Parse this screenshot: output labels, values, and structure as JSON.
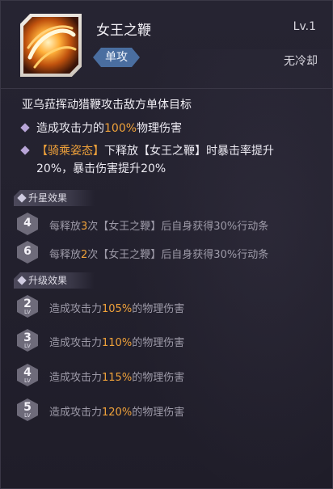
{
  "skill": {
    "name": "女王之鞭",
    "level": "Lv.1",
    "tag": "单攻",
    "cooldown": "无冷却",
    "description": "亚乌菈挥动猎鞭攻击敌方单体目标",
    "icon": "whip-slash-icon"
  },
  "effects": [
    {
      "pre": "造成攻击力的",
      "hl": "100%",
      "post": "物理伤害"
    },
    {
      "hl": "【骑乘姿态】",
      "post": "下释放【女王之鞭】时暴击率提升",
      "line2": "20%，暴击伤害提升20%"
    }
  ],
  "star_section": {
    "title": "升星效果",
    "items": [
      {
        "star": "4",
        "pre": "每释放",
        "hl": "3",
        "post": "次【女王之鞭】后自身获得30%行动条"
      },
      {
        "star": "6",
        "pre": "每释放",
        "hl": "2",
        "post": "次【女王之鞭】后自身获得30%行动条"
      }
    ]
  },
  "upgrade_section": {
    "title": "升级效果",
    "lv_label": "LV",
    "items": [
      {
        "level": "2",
        "pre": "造成攻击力",
        "hl": "105%",
        "post": "的物理伤害"
      },
      {
        "level": "3",
        "pre": "造成攻击力",
        "hl": "110%",
        "post": "的物理伤害"
      },
      {
        "level": "4",
        "pre": "造成攻击力",
        "hl": "115%",
        "post": "的物理伤害"
      },
      {
        "level": "5",
        "pre": "造成攻击力",
        "hl": "120%",
        "post": "的物理伤害"
      }
    ]
  },
  "colors": {
    "accent_orange": "#f0a23a",
    "tag_blue": "#4a6ea0",
    "background": "#1f1d2a"
  }
}
